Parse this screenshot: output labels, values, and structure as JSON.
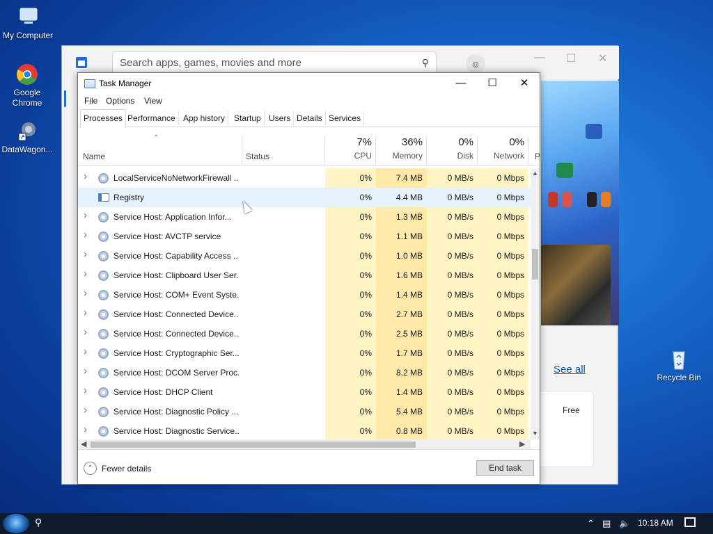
{
  "desktop": {
    "icons": [
      {
        "label": "My Computer"
      },
      {
        "label": "Google Chrome"
      },
      {
        "label": "DataWagon..."
      },
      {
        "label": "Recycle Bin"
      }
    ]
  },
  "store": {
    "search_placeholder": "Search apps, games, movies and more",
    "see_all": "See all",
    "free_label": "Free"
  },
  "task_manager": {
    "title": "Task Manager",
    "menu": [
      "File",
      "Options",
      "View"
    ],
    "tabs": [
      "Processes",
      "Performance",
      "App history",
      "Startup",
      "Users",
      "Details",
      "Services"
    ],
    "active_tab": "Processes",
    "columns": {
      "name": "Name",
      "status": "Status",
      "cpu": {
        "pct": "7%",
        "label": "CPU"
      },
      "memory": {
        "pct": "36%",
        "label": "Memory"
      },
      "disk": {
        "pct": "0%",
        "label": "Disk"
      },
      "network": {
        "pct": "0%",
        "label": "Network"
      },
      "power_partial": "P"
    },
    "rows": [
      {
        "name": "LocalServiceNoNetworkFirewall ...",
        "cpu": "0%",
        "memory": "7.4 MB",
        "disk": "0 MB/s",
        "network": "0 Mbps",
        "expandable": true,
        "icon": "gear-icon"
      },
      {
        "name": "Registry",
        "cpu": "0%",
        "memory": "4.4 MB",
        "disk": "0 MB/s",
        "network": "0 Mbps",
        "expandable": false,
        "icon": "registry-icon"
      },
      {
        "name": "Service Host: Application Infor...",
        "cpu": "0%",
        "memory": "1.3 MB",
        "disk": "0 MB/s",
        "network": "0 Mbps",
        "expandable": true,
        "icon": "gear-icon"
      },
      {
        "name": "Service Host: AVCTP service",
        "cpu": "0%",
        "memory": "1.1 MB",
        "disk": "0 MB/s",
        "network": "0 Mbps",
        "expandable": true,
        "icon": "gear-icon"
      },
      {
        "name": "Service Host: Capability Access ...",
        "cpu": "0%",
        "memory": "1.0 MB",
        "disk": "0 MB/s",
        "network": "0 Mbps",
        "expandable": true,
        "icon": "gear-icon"
      },
      {
        "name": "Service Host: Clipboard User Ser...",
        "cpu": "0%",
        "memory": "1.6 MB",
        "disk": "0 MB/s",
        "network": "0 Mbps",
        "expandable": true,
        "icon": "gear-icon"
      },
      {
        "name": "Service Host: COM+ Event Syste...",
        "cpu": "0%",
        "memory": "1.4 MB",
        "disk": "0 MB/s",
        "network": "0 Mbps",
        "expandable": true,
        "icon": "gear-icon"
      },
      {
        "name": "Service Host: Connected Device...",
        "cpu": "0%",
        "memory": "2.7 MB",
        "disk": "0 MB/s",
        "network": "0 Mbps",
        "expandable": true,
        "icon": "gear-icon"
      },
      {
        "name": "Service Host: Connected Device...",
        "cpu": "0%",
        "memory": "2.5 MB",
        "disk": "0 MB/s",
        "network": "0 Mbps",
        "expandable": true,
        "icon": "gear-icon"
      },
      {
        "name": "Service Host: Cryptographic Ser...",
        "cpu": "0%",
        "memory": "1.7 MB",
        "disk": "0 MB/s",
        "network": "0 Mbps",
        "expandable": true,
        "icon": "gear-icon"
      },
      {
        "name": "Service Host: DCOM Server Proc...",
        "cpu": "0%",
        "memory": "8.2 MB",
        "disk": "0 MB/s",
        "network": "0 Mbps",
        "expandable": true,
        "icon": "gear-icon"
      },
      {
        "name": "Service Host: DHCP Client",
        "cpu": "0%",
        "memory": "1.4 MB",
        "disk": "0 MB/s",
        "network": "0 Mbps",
        "expandable": true,
        "icon": "gear-icon"
      },
      {
        "name": "Service Host: Diagnostic Policy ...",
        "cpu": "0%",
        "memory": "5.4 MB",
        "disk": "0 MB/s",
        "network": "0 Mbps",
        "expandable": true,
        "icon": "gear-icon"
      },
      {
        "name": "Service Host: Diagnostic Service...",
        "cpu": "0%",
        "memory": "0.8 MB",
        "disk": "0 MB/s",
        "network": "0 Mbps",
        "expandable": true,
        "icon": "gear-icon"
      }
    ],
    "selected_row": "Registry",
    "footer": {
      "fewer_details": "Fewer details",
      "end_task": "End task"
    }
  },
  "taskbar": {
    "clock": "10:18 AM"
  },
  "colors": {
    "column_highlight": "#fff4c4",
    "memory_highlight": "#ffe9a8",
    "selection": "#e5f1fb"
  }
}
